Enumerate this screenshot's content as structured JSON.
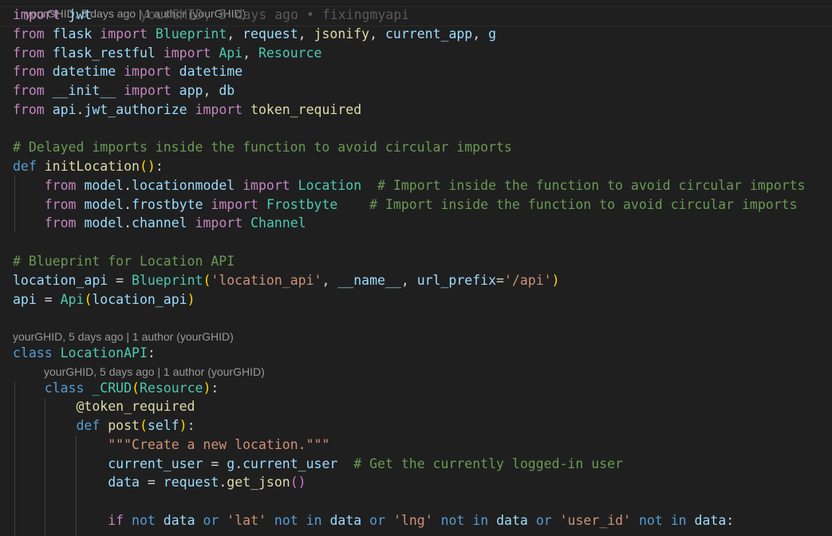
{
  "editor": {
    "top_codelens": "yourGHID, 5 days ago | 1 author (yourGHID)",
    "line_blame": "yourGHID, 5 days ago • fixingmyapi",
    "lines": [
      [
        [
          "kw",
          "import"
        ],
        [
          "tx",
          " "
        ],
        [
          "va",
          "jwt"
        ]
      ],
      [
        [
          "kw",
          "from"
        ],
        [
          "tx",
          " "
        ],
        [
          "va",
          "flask"
        ],
        [
          "tx",
          " "
        ],
        [
          "kw",
          "import"
        ],
        [
          "tx",
          " "
        ],
        [
          "cl",
          "Blueprint"
        ],
        [
          "tx",
          ", "
        ],
        [
          "va",
          "request"
        ],
        [
          "tx",
          ", "
        ],
        [
          "fn",
          "jsonify"
        ],
        [
          "tx",
          ", "
        ],
        [
          "va",
          "current_app"
        ],
        [
          "tx",
          ", "
        ],
        [
          "va",
          "g"
        ]
      ],
      [
        [
          "kw",
          "from"
        ],
        [
          "tx",
          " "
        ],
        [
          "va",
          "flask_restful"
        ],
        [
          "tx",
          " "
        ],
        [
          "kw",
          "import"
        ],
        [
          "tx",
          " "
        ],
        [
          "cl",
          "Api"
        ],
        [
          "tx",
          ", "
        ],
        [
          "cl",
          "Resource"
        ]
      ],
      [
        [
          "kw",
          "from"
        ],
        [
          "tx",
          " "
        ],
        [
          "va",
          "datetime"
        ],
        [
          "tx",
          " "
        ],
        [
          "kw",
          "import"
        ],
        [
          "tx",
          " "
        ],
        [
          "va",
          "datetime"
        ]
      ],
      [
        [
          "kw",
          "from"
        ],
        [
          "tx",
          " "
        ],
        [
          "va",
          "__init__"
        ],
        [
          "tx",
          " "
        ],
        [
          "kw",
          "import"
        ],
        [
          "tx",
          " "
        ],
        [
          "va",
          "app"
        ],
        [
          "tx",
          ", "
        ],
        [
          "va",
          "db"
        ]
      ],
      [
        [
          "kw",
          "from"
        ],
        [
          "tx",
          " "
        ],
        [
          "va",
          "api"
        ],
        [
          "tx",
          "."
        ],
        [
          "va",
          "jwt_authorize"
        ],
        [
          "tx",
          " "
        ],
        [
          "kw",
          "import"
        ],
        [
          "tx",
          " "
        ],
        [
          "fn",
          "token_required"
        ]
      ],
      [],
      [
        [
          "cm",
          "# Delayed imports inside the function to avoid circular imports"
        ]
      ],
      [
        [
          "bl",
          "def"
        ],
        [
          "tx",
          " "
        ],
        [
          "fn",
          "initLocation"
        ],
        [
          "p1",
          "()"
        ],
        [
          "tx",
          ":"
        ]
      ],
      [
        [
          "tx",
          "    "
        ],
        [
          "kw",
          "from"
        ],
        [
          "tx",
          " "
        ],
        [
          "va",
          "model"
        ],
        [
          "tx",
          "."
        ],
        [
          "va",
          "locationmodel"
        ],
        [
          "tx",
          " "
        ],
        [
          "kw",
          "import"
        ],
        [
          "tx",
          " "
        ],
        [
          "cl",
          "Location"
        ],
        [
          "tx",
          "  "
        ],
        [
          "cm",
          "# Import inside the function to avoid circular imports"
        ]
      ],
      [
        [
          "tx",
          "    "
        ],
        [
          "kw",
          "from"
        ],
        [
          "tx",
          " "
        ],
        [
          "va",
          "model"
        ],
        [
          "tx",
          "."
        ],
        [
          "va",
          "frostbyte"
        ],
        [
          "tx",
          " "
        ],
        [
          "kw",
          "import"
        ],
        [
          "tx",
          " "
        ],
        [
          "cl",
          "Frostbyte"
        ],
        [
          "tx",
          "    "
        ],
        [
          "cm",
          "# Import inside the function to avoid circular imports"
        ]
      ],
      [
        [
          "tx",
          "    "
        ],
        [
          "kw",
          "from"
        ],
        [
          "tx",
          " "
        ],
        [
          "va",
          "model"
        ],
        [
          "tx",
          "."
        ],
        [
          "va",
          "channel"
        ],
        [
          "tx",
          " "
        ],
        [
          "kw",
          "import"
        ],
        [
          "tx",
          " "
        ],
        [
          "cl",
          "Channel"
        ]
      ],
      [],
      [
        [
          "cm",
          "# Blueprint for Location API"
        ]
      ],
      [
        [
          "va",
          "location_api"
        ],
        [
          "tx",
          " = "
        ],
        [
          "cl",
          "Blueprint"
        ],
        [
          "p1",
          "("
        ],
        [
          "st",
          "'location_api'"
        ],
        [
          "tx",
          ", "
        ],
        [
          "va",
          "__name__"
        ],
        [
          "tx",
          ", "
        ],
        [
          "va",
          "url_prefix"
        ],
        [
          "tx",
          "="
        ],
        [
          "st",
          "'/api'"
        ],
        [
          "p1",
          ")"
        ]
      ],
      [
        [
          "va",
          "api"
        ],
        [
          "tx",
          " = "
        ],
        [
          "cl",
          "Api"
        ],
        [
          "p1",
          "("
        ],
        [
          "va",
          "location_api"
        ],
        [
          "p1",
          ")"
        ]
      ],
      [],
      [
        [
          "bl",
          "class"
        ],
        [
          "tx",
          " "
        ],
        [
          "cl",
          "LocationAPI"
        ],
        [
          "tx",
          ":"
        ]
      ],
      [
        [
          "tx",
          "    "
        ],
        [
          "bl",
          "class"
        ],
        [
          "tx",
          " "
        ],
        [
          "cl",
          "_CRUD"
        ],
        [
          "p1",
          "("
        ],
        [
          "cl",
          "Resource"
        ],
        [
          "p1",
          ")"
        ],
        [
          "tx",
          ":"
        ]
      ],
      [
        [
          "tx",
          "        "
        ],
        [
          "fn",
          "@token_required"
        ]
      ],
      [
        [
          "tx",
          "        "
        ],
        [
          "bl",
          "def"
        ],
        [
          "tx",
          " "
        ],
        [
          "fn",
          "post"
        ],
        [
          "p1",
          "("
        ],
        [
          "va",
          "self"
        ],
        [
          "p1",
          ")"
        ],
        [
          "tx",
          ":"
        ]
      ],
      [
        [
          "tx",
          "            "
        ],
        [
          "st",
          "\"\"\"Create a new location.\"\"\""
        ]
      ],
      [
        [
          "tx",
          "            "
        ],
        [
          "va",
          "current_user"
        ],
        [
          "tx",
          " = "
        ],
        [
          "va",
          "g"
        ],
        [
          "tx",
          "."
        ],
        [
          "va",
          "current_user"
        ],
        [
          "tx",
          "  "
        ],
        [
          "cm",
          "# Get the currently logged-in user"
        ]
      ],
      [
        [
          "tx",
          "            "
        ],
        [
          "va",
          "data"
        ],
        [
          "tx",
          " = "
        ],
        [
          "va",
          "request"
        ],
        [
          "tx",
          "."
        ],
        [
          "fn",
          "get_json"
        ],
        [
          "p2",
          "()"
        ]
      ],
      [],
      [
        [
          "tx",
          "            "
        ],
        [
          "kw",
          "if"
        ],
        [
          "tx",
          " "
        ],
        [
          "bl",
          "not"
        ],
        [
          "tx",
          " "
        ],
        [
          "va",
          "data"
        ],
        [
          "tx",
          " "
        ],
        [
          "bl",
          "or"
        ],
        [
          "tx",
          " "
        ],
        [
          "st",
          "'lat'"
        ],
        [
          "tx",
          " "
        ],
        [
          "bl",
          "not"
        ],
        [
          "tx",
          " "
        ],
        [
          "bl",
          "in"
        ],
        [
          "tx",
          " "
        ],
        [
          "va",
          "data"
        ],
        [
          "tx",
          " "
        ],
        [
          "bl",
          "or"
        ],
        [
          "tx",
          " "
        ],
        [
          "st",
          "'lng'"
        ],
        [
          "tx",
          " "
        ],
        [
          "bl",
          "not"
        ],
        [
          "tx",
          " "
        ],
        [
          "bl",
          "in"
        ],
        [
          "tx",
          " "
        ],
        [
          "va",
          "data"
        ],
        [
          "tx",
          " "
        ],
        [
          "bl",
          "or"
        ],
        [
          "tx",
          " "
        ],
        [
          "st",
          "'user_id'"
        ],
        [
          "tx",
          " "
        ],
        [
          "bl",
          "not"
        ],
        [
          "tx",
          " "
        ],
        [
          "bl",
          "in"
        ],
        [
          "tx",
          " "
        ],
        [
          "va",
          "data"
        ],
        [
          "tx",
          ":"
        ]
      ]
    ],
    "codelens": [
      {
        "before_line": 17,
        "text": "yourGHID, 5 days ago | 1 author (yourGHID)"
      },
      {
        "before_line": 18,
        "text": "yourGHID, 5 days ago | 1 author (yourGHID)"
      }
    ]
  }
}
